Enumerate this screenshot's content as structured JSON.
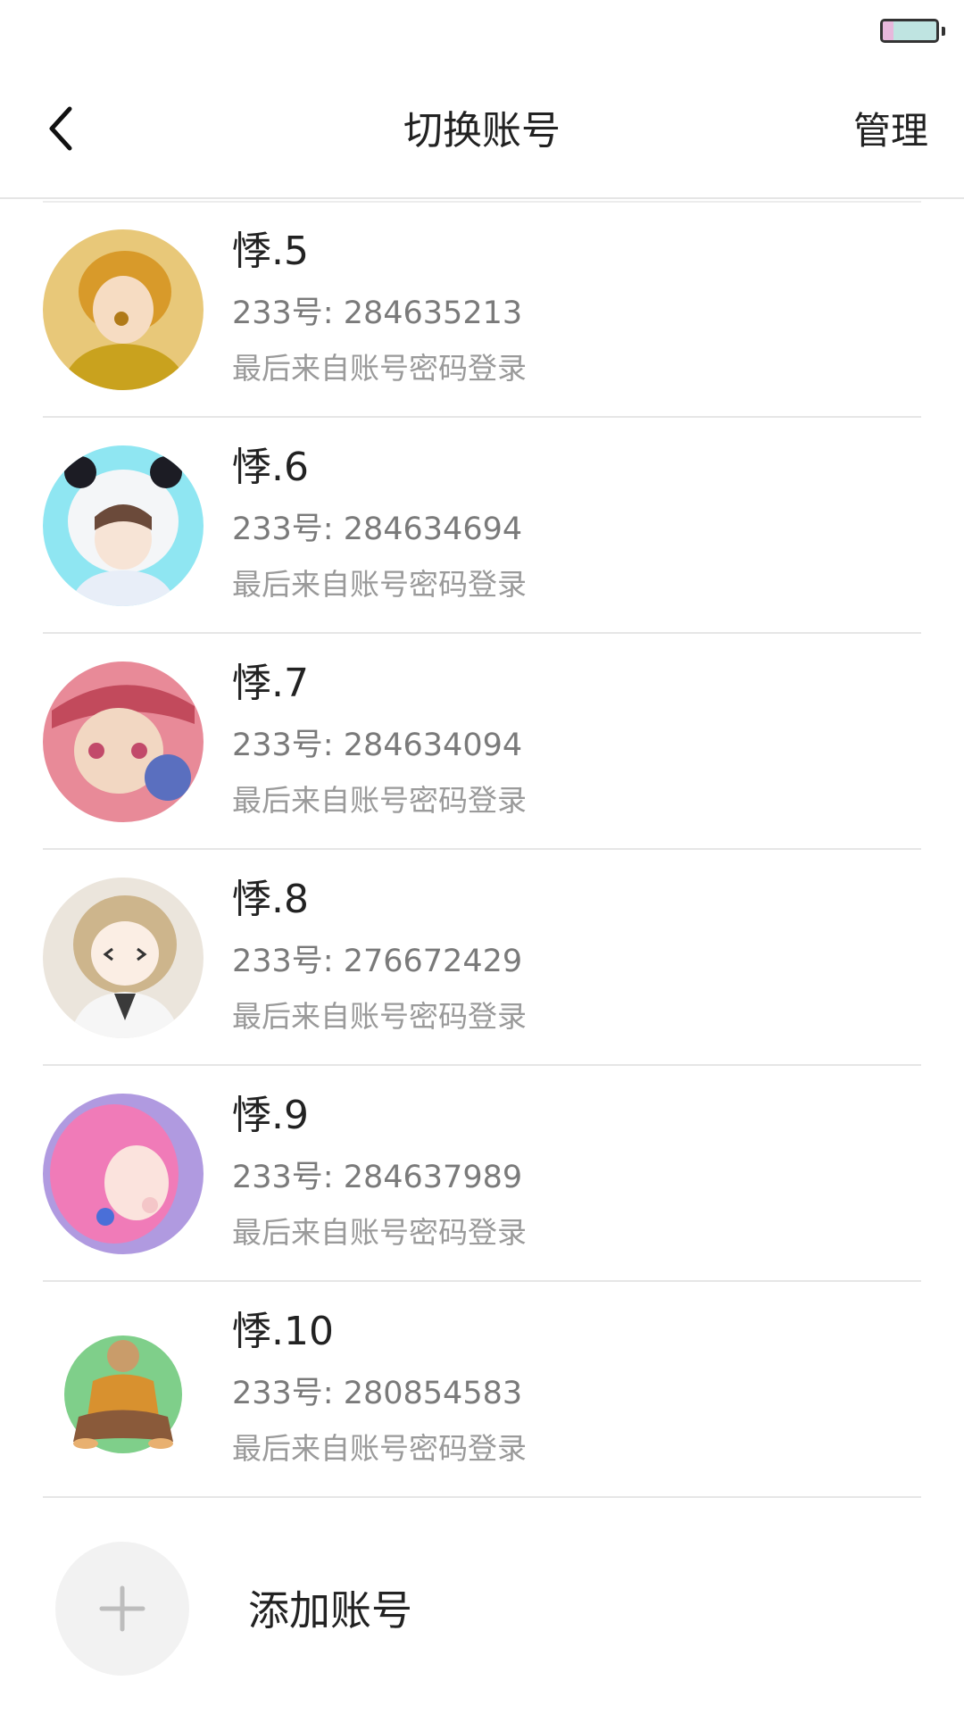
{
  "status_bar": {
    "battery_level": 0.2,
    "battery_color": "#bfe4e1",
    "battery_fill_color": "#e7b8dc"
  },
  "nav": {
    "back_icon": "chevron-left-icon",
    "title": "切换账号",
    "manage_label": "管理"
  },
  "accounts": [
    {
      "name": "悸.5",
      "id_text": "233号: 284635213",
      "login_text": "最后来自账号密码登录",
      "avatar_bg": "#e8c879",
      "avatar_fg": "#d89a2a",
      "avatar_accent": "#c9a21e"
    },
    {
      "name": "悸.6",
      "id_text": "233号: 284634694",
      "login_text": "最后来自账号密码登录",
      "avatar_bg": "#8fe6f2",
      "avatar_fg": "#f4f6f8",
      "avatar_accent": "#1c1c24"
    },
    {
      "name": "悸.7",
      "id_text": "233号: 284634094",
      "login_text": "最后来自账号密码登录",
      "avatar_bg": "#e88a98",
      "avatar_fg": "#f2d7c2",
      "avatar_accent": "#c24a5c"
    },
    {
      "name": "悸.8",
      "id_text": "233号: 276672429",
      "login_text": "最后来自账号密码登录",
      "avatar_bg": "#ebe5dc",
      "avatar_fg": "#cdb58c",
      "avatar_accent": "#3a3a3a"
    },
    {
      "name": "悸.9",
      "id_text": "233号: 284637989",
      "login_text": "最后来自账号密码登录",
      "avatar_bg": "#b09ae0",
      "avatar_fg": "#f07bb8",
      "avatar_accent": "#f4c6c8"
    },
    {
      "name": "悸.10",
      "id_text": "233号: 280854583",
      "login_text": "最后来自账号密码登录",
      "avatar_bg": "#ffffff",
      "avatar_fg": "#7fcf8a",
      "avatar_accent": "#d8912f"
    }
  ],
  "add_account": {
    "icon": "plus-icon",
    "label": "添加账号"
  }
}
